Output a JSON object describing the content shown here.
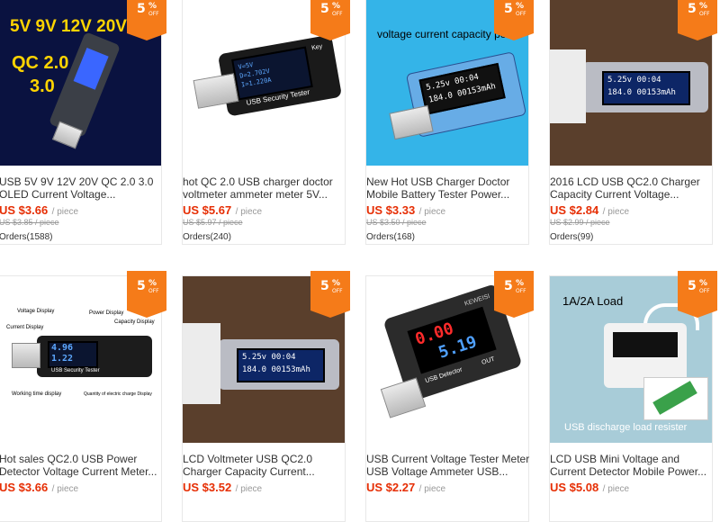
{
  "products": [
    {
      "badge": {
        "value": "5",
        "sign": "%",
        "suffix": "OFF"
      },
      "title_line1": "USB 5V 9V 12V 20V QC 2.0 3.0",
      "title_line2": "OLED Current Voltage...",
      "price": "US $3.66",
      "unit": "/ piece",
      "original_price": "US $3.85 / piece",
      "orders": "Orders(1588)",
      "image_text": [
        "5V 9V 12V 20V",
        "QC 2.0",
        "3.0"
      ]
    },
    {
      "badge": {
        "value": "5",
        "sign": "%",
        "suffix": "OFF"
      },
      "title_line1": "hot QC 2.0 USB charger doctor",
      "title_line2": "voltmeter ammeter meter 5V...",
      "price": "US $5.67",
      "unit": "/ piece",
      "original_price": "US $5.97 / piece",
      "orders": "Orders(240)",
      "image_text": [
        "USB Security Tester",
        "Key"
      ]
    },
    {
      "badge": {
        "value": "5",
        "sign": "%",
        "suffix": "OFF"
      },
      "title_line1": "New Hot USB Charger Doctor",
      "title_line2": "Mobile Battery Tester Power...",
      "price": "US $3.33",
      "unit": "/ piece",
      "original_price": "US $3.50 / piece",
      "orders": "Orders(168)",
      "image_text": [
        "voltage current capacity power",
        "5.25v 00:04",
        "184.0 00153mAh"
      ]
    },
    {
      "badge": {
        "value": "5",
        "sign": "%",
        "suffix": "OFF"
      },
      "title_line1": "2016 LCD USB QC2.0 Charger",
      "title_line2": "Capacity Current Voltage...",
      "price": "US $2.84",
      "unit": "/ piece",
      "original_price": "US $2.99 / piece",
      "orders": "Orders(99)",
      "image_text": [
        "5.25v 00:04",
        "184.0 00153mAh"
      ]
    },
    {
      "badge": {
        "value": "5",
        "sign": "%",
        "suffix": "OFF"
      },
      "title_line1": "Hot sales QC2.0 USB Power",
      "title_line2": "Detector Voltage Current Meter...",
      "price": "US $3.66",
      "unit": "/ piece",
      "image_text": [
        "Voltage Display",
        "Power Display",
        "Current Display",
        "Capacity Display",
        "4.96",
        "1.22",
        "USB Security Tester",
        "Working time display",
        "Quantity of electric charge Display"
      ]
    },
    {
      "badge": {
        "value": "5",
        "sign": "%",
        "suffix": "OFF"
      },
      "title_line1": "LCD Voltmeter USB QC2.0",
      "title_line2": "Charger Capacity Current...",
      "price": "US $3.52",
      "unit": "/ piece",
      "image_text": [
        "5.25v 00:04",
        "184.0 00153mAh"
      ]
    },
    {
      "badge": {
        "value": "5",
        "sign": "%",
        "suffix": "OFF"
      },
      "title_line1": "USB Current Voltage Tester Meter",
      "title_line2": "USB Voltage Ammeter USB...",
      "price": "US $2.27",
      "unit": "/ piece",
      "image_text": [
        "KEWEISI",
        "0.00",
        "5.19",
        "USB Detector",
        "OUT"
      ]
    },
    {
      "badge": {
        "value": "5",
        "sign": "%",
        "suffix": "OFF"
      },
      "title_line1": "LCD USB Mini Voltage and",
      "title_line2": "Current Detector Mobile Power...",
      "price": "US $5.08",
      "unit": "/ piece",
      "image_text": [
        "1A/2A Load",
        "USB discharge load resister"
      ]
    }
  ],
  "colors": {
    "badge": "#f57b19",
    "price": "#e62e04",
    "lcd_blue": "#5da8ff"
  }
}
